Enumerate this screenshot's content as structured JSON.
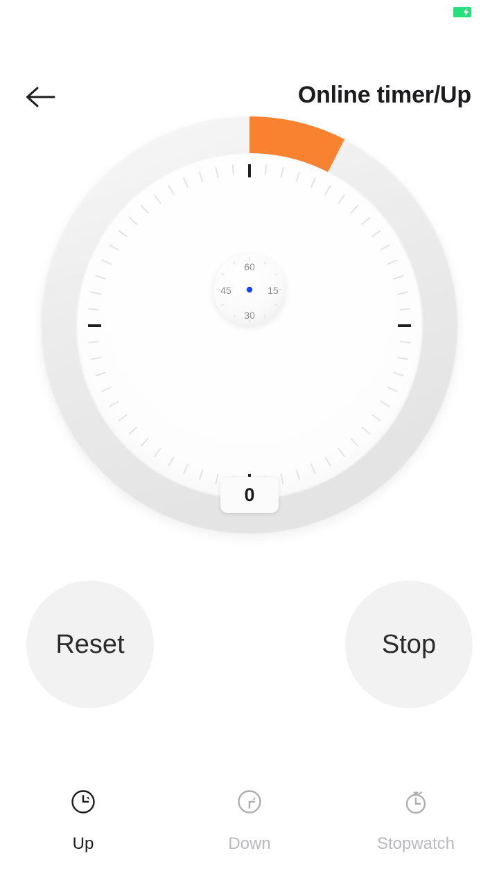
{
  "statusbar": {
    "battery_icon": "battery-charging-icon",
    "battery_color": "#25E07C"
  },
  "header": {
    "back_icon": "arrow-left-icon",
    "title": "Online timer/Up"
  },
  "timer": {
    "value": "0",
    "accent_color": "#F98231",
    "ring_color": "#EDEDED",
    "face_color": "#FFFFFF",
    "elapsed_fraction": 0.075,
    "dots_count": 60,
    "minor_ticks": 60,
    "major_tick_positions": [
      0,
      15,
      30,
      45
    ],
    "mini_clock": {
      "labels": [
        "60",
        "15",
        "30",
        "45"
      ],
      "needle_position": 0,
      "needle_color_top": "#4FC3F7",
      "needle_color_bottom": "#1A46F0"
    }
  },
  "controls": {
    "reset_label": "Reset",
    "stop_label": "Stop"
  },
  "tabs": [
    {
      "label": "Up",
      "icon": "clock-up-icon",
      "active": true
    },
    {
      "label": "Down",
      "icon": "clock-down-icon",
      "active": false
    },
    {
      "label": "Stopwatch",
      "icon": "stopwatch-icon",
      "active": false
    }
  ]
}
